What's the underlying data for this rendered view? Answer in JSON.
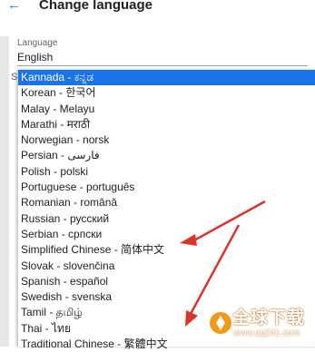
{
  "header": {
    "back_icon": "back-arrow-icon",
    "title": "Change language"
  },
  "language_field": {
    "label": "Language",
    "value": "English"
  },
  "clipped_letter": "S",
  "options": [
    {
      "label": "Kannada - ಕನ್ನಡ",
      "selected": true
    },
    {
      "label": "Korean - 한국어"
    },
    {
      "label": "Malay - Melayu"
    },
    {
      "label": "Marathi - मराठी"
    },
    {
      "label": "Norwegian - norsk"
    },
    {
      "label": "Persian - فارسی"
    },
    {
      "label": "Polish - polski"
    },
    {
      "label": "Portuguese - português"
    },
    {
      "label": "Romanian - română"
    },
    {
      "label": "Russian - русский"
    },
    {
      "label": "Serbian - српски"
    },
    {
      "label": "Simplified Chinese - 简体中文"
    },
    {
      "label": "Slovak - slovenčina"
    },
    {
      "label": "Spanish - español"
    },
    {
      "label": "Swedish - svenska"
    },
    {
      "label": "Tamil - தமிழ்"
    },
    {
      "label": "Thai - ไทย"
    },
    {
      "label": "Traditional Chinese - 繁體中文"
    }
  ],
  "colors": {
    "accent": "#1a73e8",
    "annotation_arrow": "#d9362b",
    "watermark_orange": "#f29a17"
  },
  "watermark": {
    "text": "全球下载",
    "url": "www.qq241.com"
  }
}
